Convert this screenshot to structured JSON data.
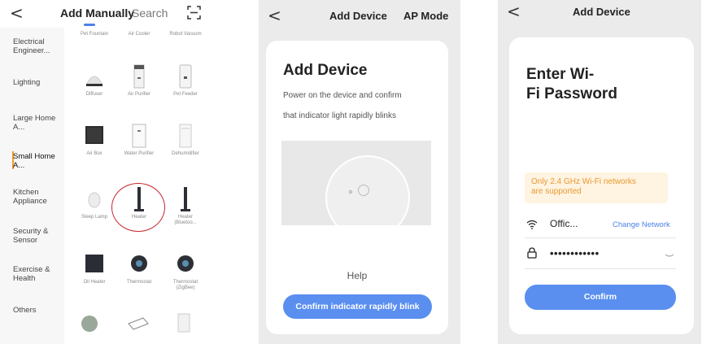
{
  "panel_add_manually": {
    "back_glyph": "<",
    "title": "Add Manually",
    "search_label": "Search",
    "scan_icon": "scan-icon",
    "categories": [
      "Electrical Engineer...",
      "Lighting",
      "Large Home A...",
      "Small Home A...",
      "Kitchen Appliance",
      "Security & Sensor",
      "Exercise & Health",
      "Others"
    ],
    "active_category_index": 3,
    "top_row_labels": [
      "Pet Fountain",
      "Air Cooler",
      "Robot Vacuum"
    ],
    "devices": [
      {
        "label": "Diffuser",
        "icon": "diffuser-icon"
      },
      {
        "label": "Air Purifier",
        "icon": "air-purifier-icon"
      },
      {
        "label": "Pet Feeder",
        "icon": "pet-feeder-icon"
      },
      {
        "label": "Air Box",
        "icon": "air-box-icon"
      },
      {
        "label": "Water Purifier",
        "icon": "water-purifier-icon"
      },
      {
        "label": "Dehumidifier",
        "icon": "dehumidifier-icon"
      },
      {
        "label": "Sleep Lamp",
        "icon": "sleep-lamp-icon"
      },
      {
        "label": "Heater",
        "icon": "heater-icon"
      },
      {
        "label": "Heater (Bluetoo...",
        "icon": "heater-bluetooth-icon"
      },
      {
        "label": "Oil Heater",
        "icon": "oil-heater-icon"
      },
      {
        "label": "Thermostat",
        "icon": "thermostat-icon"
      },
      {
        "label": "Thermostat (ZigBee)",
        "icon": "thermostat-zigbee-icon"
      }
    ],
    "highlighted_device": "Heater",
    "highlight_color": "#c5262d",
    "accent_color": "#4b82ea",
    "active_bar_color": "#f39a2c"
  },
  "panel_add_device": {
    "back_glyph": "<",
    "nav_title": "Add Device",
    "mode_label": "AP Mode",
    "heading": "Add Device",
    "description_line1": "Power on the device and confirm",
    "description_line2": "that indicator light rapidly blinks",
    "help_label": "Help",
    "confirm_button": "Confirm indicator rapidly blink",
    "button_color": "#5a8ff0"
  },
  "panel_wifi": {
    "back_glyph": "<",
    "nav_title": "Add Device",
    "heading_line1": "Enter Wi-",
    "heading_line2": "Fi Password",
    "warning_line1": "Only 2.4 GHz Wi-Fi networks",
    "warning_line2": "are supported",
    "warning_color": "#e79a30",
    "ssid": "Offic...",
    "change_network": "Change Network",
    "password": "••••••••••••",
    "confirm_button": "Confirm"
  }
}
